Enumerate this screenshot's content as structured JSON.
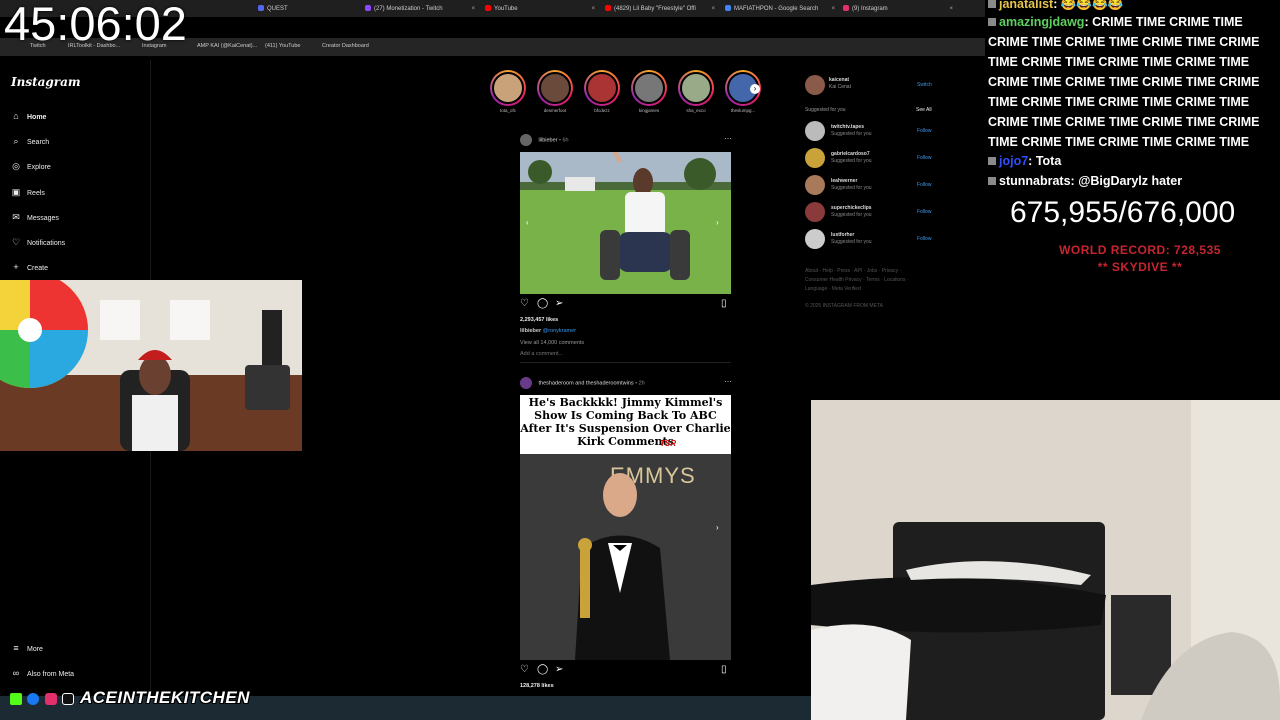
{
  "timer": "45:06:02",
  "browser": {
    "tabs": [
      {
        "label": "QUEST"
      },
      {
        "label": "(27) Monetization - Twitch"
      },
      {
        "label": "YouTube"
      },
      {
        "label": "(4829) Lil Baby \"Freestyle\" Offi"
      },
      {
        "label": "MAFIATHPON - Google Search"
      },
      {
        "label": "(9) Instagram"
      }
    ],
    "bookmarks": [
      {
        "label": "Twitch"
      },
      {
        "label": "IRLToolkit - Dashbo..."
      },
      {
        "label": "Instagram"
      },
      {
        "label": "AMP KAI (@KaiCenat)..."
      },
      {
        "label": "(411) YouTube"
      },
      {
        "label": "Creator Dashboard"
      }
    ]
  },
  "instagram": {
    "logo": "Instagram",
    "nav": [
      {
        "label": "Home",
        "icon": "home-icon"
      },
      {
        "label": "Search",
        "icon": "search-icon"
      },
      {
        "label": "Explore",
        "icon": "compass-icon"
      },
      {
        "label": "Reels",
        "icon": "reels-icon"
      },
      {
        "label": "Messages",
        "icon": "messenger-icon"
      },
      {
        "label": "Notifications",
        "icon": "heart-icon"
      },
      {
        "label": "Create",
        "icon": "plus-icon"
      }
    ],
    "nav_bottom": [
      {
        "label": "More",
        "icon": "menu-icon"
      },
      {
        "label": "Also from Meta",
        "icon": "meta-icon"
      }
    ],
    "stories": [
      {
        "name": "tota_ofc",
        "color": "#c9a27a"
      },
      {
        "name": "desmerfoot",
        "color": "#6a4a3a"
      },
      {
        "name": "bfcdezz",
        "color": "#a33"
      },
      {
        "name": "kingjames",
        "color": "#777"
      },
      {
        "name": "sha_exco",
        "color": "#9a8"
      },
      {
        "name": "theslumpg...",
        "color": "#46a"
      }
    ],
    "posts": [
      {
        "author": "lilbieber",
        "time": "6h",
        "likes": "2,293,457 likes",
        "caption_user": "lilbieber",
        "caption_tag": "@ronykramer",
        "comments": "View all 14,000 comments",
        "add_comment": "Add a comment..."
      },
      {
        "author": "theshaderoom and theshaderoomtwins",
        "time": "2h",
        "headline": "He's Backkkk! Jimmy Kimmel's Show Is Coming Back To ABC After It's Suspension Over Charlie Kirk Comments",
        "tsr": "TSR",
        "emmys": "EMMYS",
        "likes": "128,278 likes"
      }
    ],
    "account": {
      "username": "kaicenat",
      "name": "Kai Cenat",
      "switch": "Switch"
    },
    "suggested_title": "Suggested for you",
    "see_all": "See All",
    "suggested": [
      {
        "name": "twitchtv.tapes",
        "sub": "Suggested for you",
        "follow": "Follow"
      },
      {
        "name": "gabrielcardoso7",
        "sub": "Suggested for you",
        "follow": "Follow"
      },
      {
        "name": "leahwerner",
        "sub": "Suggested for you",
        "follow": "Follow"
      },
      {
        "name": "superchickeclips",
        "sub": "Suggested for you",
        "follow": "Follow"
      },
      {
        "name": "lustforher",
        "sub": "Suggested for you",
        "follow": "Follow"
      }
    ],
    "footer_links": "About · Help · Press · API · Jobs · Privacy · Consumer Health Privacy · Terms · Locations · Language · Meta Verified",
    "copyright": "© 2025 INSTAGRAM FROM META"
  },
  "chat": {
    "messages": [
      {
        "user": "janatalist",
        "text": "😂😂😂😂",
        "color": "#e6c34a"
      },
      {
        "user": "amazingjdawg",
        "text": "CRIME TIME CRIME TIME CRIME TIME CRIME TIME CRIME TIME CRIME TIME CRIME TIME CRIME TIME CRIME TIME CRIME TIME CRIME TIME CRIME TIME CRIME TIME CRIME TIME CRIME TIME CRIME TIME CRIME TIME CRIME TIME CRIME TIME CRIME TIME CRIME TIME CRIME TIME CRIME TIME",
        "color": "#5fd05f"
      },
      {
        "user": "jojo7",
        "text": "Tota",
        "color": "#2d4fff"
      },
      {
        "user": "stunnabrats",
        "text": "@BigDarylz hater",
        "color": "#ffffff"
      }
    ]
  },
  "subathon": {
    "count": "675,955/676,000",
    "record_line1": "WORLD RECORD: 728,535",
    "record_line2": "** SKYDIVE **"
  },
  "branding": {
    "handle": "ACEINTHEKITCHEN"
  },
  "colors": {
    "instagram_blue": "#3897f0",
    "record_red": "#c7252f",
    "background": "#000000"
  }
}
